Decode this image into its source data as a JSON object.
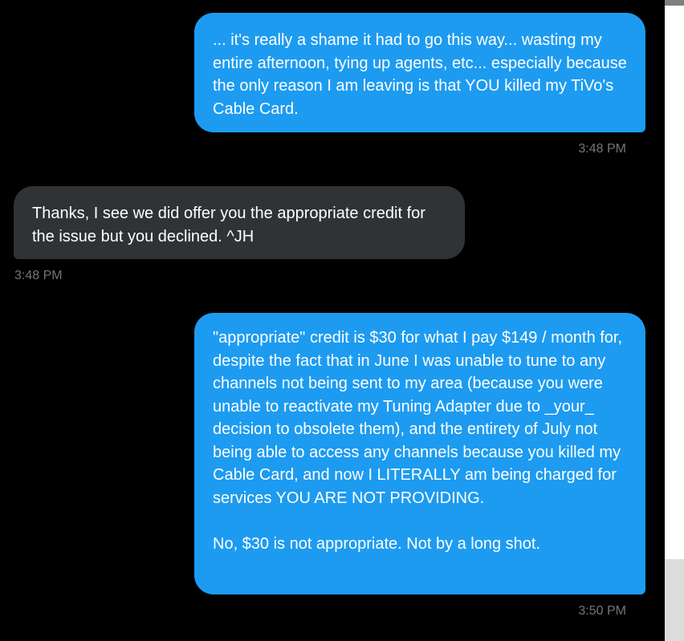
{
  "messages": [
    {
      "direction": "outgoing",
      "text": "... it's really a shame it had to go this way... wasting my entire afternoon, tying up agents, etc... especially because the only reason I am leaving is that YOU killed my TiVo's Cable Card.",
      "time": "3:48 PM"
    },
    {
      "direction": "incoming",
      "text": "Thanks, I see we did offer you the appropriate credit for the issue but you declined. ^JH",
      "time": "3:48 PM"
    },
    {
      "direction": "outgoing",
      "text": "\"appropriate\" credit is $30 for what I pay $149 / month for, despite the fact that in June I was unable to tune to any channels not being sent to my area (because you were unable to reactivate my Tuning Adapter due to _your_ decision to obsolete them), and the entirety of July not being able to access any channels because you killed my Cable Card, and now I LITERALLY am being charged for services YOU ARE NOT PROVIDING.\n\nNo, $30 is not appropriate. Not by a long shot.",
      "time": "3:50 PM"
    }
  ],
  "colors": {
    "background": "#000000",
    "outgoing_bubble": "#1d9bf0",
    "incoming_bubble": "#2f3336",
    "timestamp": "#71767b"
  }
}
